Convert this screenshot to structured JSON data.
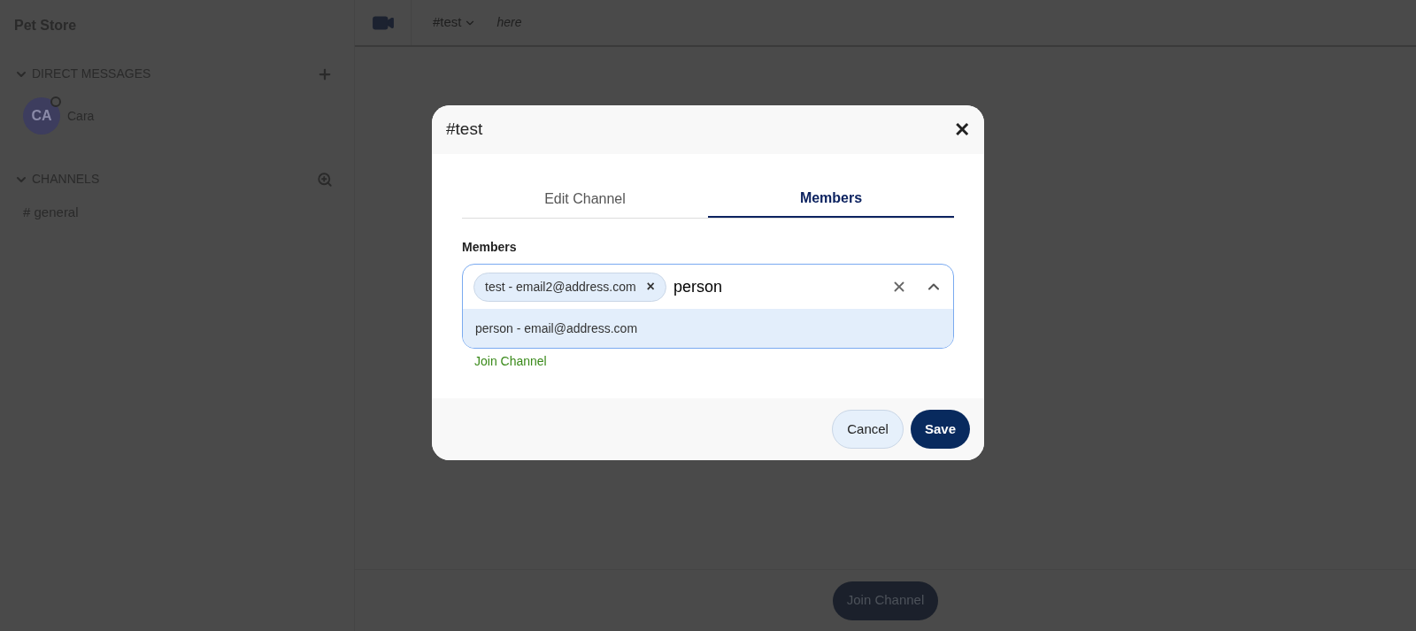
{
  "sidebar": {
    "workspace": "Pet Store",
    "sections": [
      {
        "kind": "dm",
        "title": "DIRECT MESSAGES",
        "expanded": true,
        "items": [
          {
            "initials": "CA",
            "name": "Cara"
          }
        ]
      },
      {
        "kind": "channels",
        "title": "CHANNELS",
        "expanded": true,
        "items": [
          {
            "name": "# general"
          }
        ]
      }
    ]
  },
  "header": {
    "channel": "#test",
    "topic": "here"
  },
  "footer": {
    "button": "Join Channel"
  },
  "dialog": {
    "title": "#test",
    "close": "✕",
    "tabs": [
      {
        "label": "Edit Channel",
        "selected": false
      },
      {
        "label": "Members",
        "selected": true
      }
    ],
    "field_label": "Members",
    "chips": [
      {
        "label": "test - email2@address.com",
        "remove": "×"
      }
    ],
    "value": "person",
    "expanded": true,
    "options": [
      {
        "label": "person - email@address.com",
        "selected": true
      }
    ],
    "link": "Join Channel",
    "buttons": [
      {
        "label": "Cancel",
        "kind": "secondary"
      },
      {
        "label": "Save",
        "kind": "primary"
      }
    ]
  }
}
